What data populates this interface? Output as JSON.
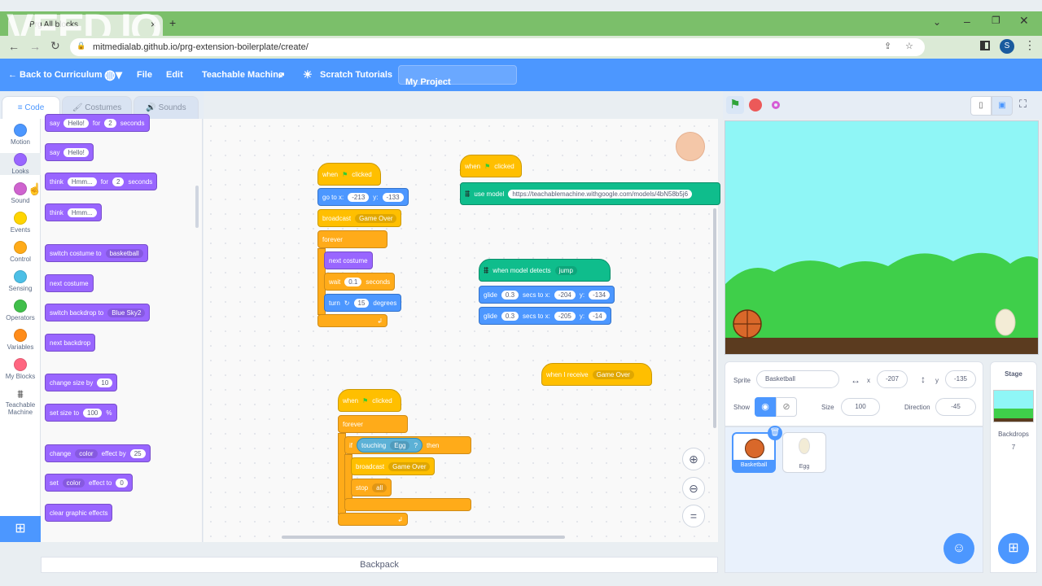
{
  "browser": {
    "tab_title": "Prg All blocks",
    "url": "mitmedialab.github.io/prg-extension-boilerplate/create/",
    "watermark": "VEED.IO",
    "profile_initial": "S"
  },
  "menu": {
    "back": "← Back to Curriculum",
    "file": "File",
    "edit": "Edit",
    "teachable": "Teachable Machine",
    "tutorials": "Scratch Tutorials",
    "project": "My Project"
  },
  "tabs": {
    "code": "Code",
    "costumes": "Costumes",
    "sounds": "Sounds"
  },
  "categories": [
    {
      "label": "Motion",
      "color": "#4c97ff"
    },
    {
      "label": "Looks",
      "color": "#9966ff"
    },
    {
      "label": "Sound",
      "color": "#cf63cf"
    },
    {
      "label": "Events",
      "color": "#ffd500"
    },
    {
      "label": "Control",
      "color": "#ffab19"
    },
    {
      "label": "Sensing",
      "color": "#4cbfe6"
    },
    {
      "label": "Operators",
      "color": "#40bf4a"
    },
    {
      "label": "Variables",
      "color": "#ff8c1a"
    },
    {
      "label": "My Blocks",
      "color": "#ff6680"
    }
  ],
  "teachable_cat": [
    "Teachable",
    "Machine"
  ],
  "palette": {
    "say_for": [
      "say",
      "Hello!",
      "for",
      "2",
      "seconds"
    ],
    "say": [
      "say",
      "Hello!"
    ],
    "think_for": [
      "think",
      "Hmm...",
      "for",
      "2",
      "seconds"
    ],
    "think": [
      "think",
      "Hmm..."
    ],
    "switch_costume": [
      "switch costume to",
      "basketball"
    ],
    "next_costume": "next costume",
    "switch_backdrop": [
      "switch backdrop to",
      "Blue Sky2"
    ],
    "next_backdrop": "next backdrop",
    "change_size": [
      "change size by",
      "10"
    ],
    "set_size": [
      "set size to",
      "100",
      "%"
    ],
    "change_effect": [
      "change",
      "color",
      "effect by",
      "25"
    ],
    "set_effect": [
      "set",
      "color",
      "effect to",
      "0"
    ],
    "clear_effects": "clear graphic effects"
  },
  "script1": {
    "when": "when",
    "clicked": "clicked",
    "goto": [
      "go to x:",
      "-213",
      "y:",
      "-133"
    ],
    "broadcast": [
      "broadcast",
      "Game Over"
    ],
    "forever": "forever",
    "next_costume": "next costume",
    "wait": [
      "wait",
      "0.1",
      "seconds"
    ],
    "turn": [
      "turn",
      "15",
      "degrees"
    ]
  },
  "script2": {
    "when": "when",
    "clicked": "clicked",
    "use_model": "use model",
    "model_url": "https://teachablemachine.withgoogle.com/models/4bN58b5j6"
  },
  "script3": {
    "detects": [
      "when model detects",
      "jump"
    ],
    "glide1": [
      "glide",
      "0.3",
      "secs to x:",
      "-204",
      "y:",
      "-134"
    ],
    "glide2": [
      "glide",
      "0.3",
      "secs to x:",
      "-205",
      "y:",
      "-14"
    ]
  },
  "script4": {
    "receive": [
      "when I receive",
      "Game Over"
    ]
  },
  "script5": {
    "when": "when",
    "clicked": "clicked",
    "forever": "forever",
    "if": "if",
    "touching": "touching",
    "egg": "Egg",
    "q": "?",
    "then": "then",
    "broadcast": [
      "broadcast",
      "Game Over"
    ],
    "stop": [
      "stop",
      "all"
    ]
  },
  "backpack": "Backpack",
  "sprite_info": {
    "sprite_label": "Sprite",
    "sprite_name": "Basketball",
    "x_label": "x",
    "x": "-207",
    "y_label": "y",
    "y": "-135",
    "show": "Show",
    "size_label": "Size",
    "size": "100",
    "direction_label": "Direction",
    "direction": "-45"
  },
  "sprites": [
    {
      "name": "Basketball"
    },
    {
      "name": "Egg"
    }
  ],
  "stage_panel": {
    "title": "Stage",
    "backdrops": "Backdrops",
    "count": "7"
  }
}
